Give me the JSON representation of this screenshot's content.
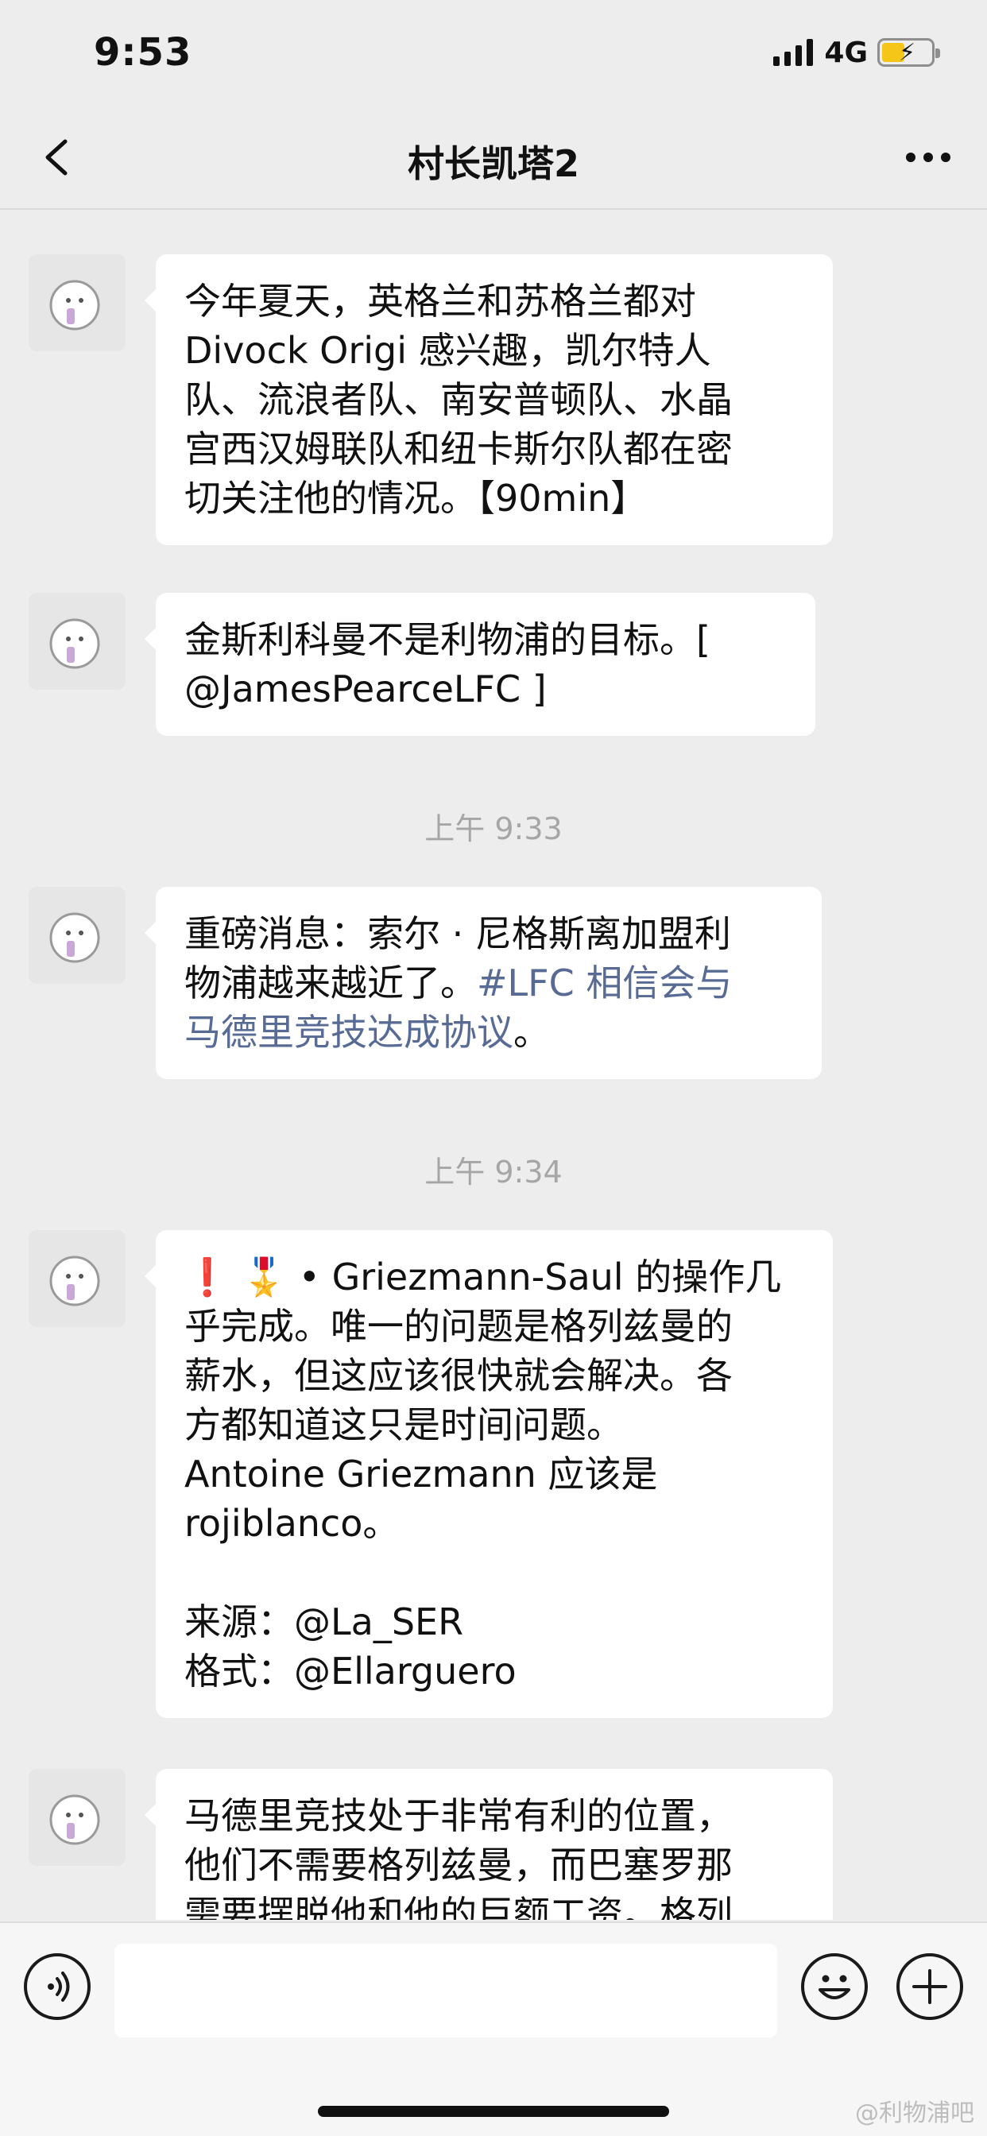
{
  "status_bar": {
    "time": "9:53",
    "network": "4G"
  },
  "nav": {
    "title": "村长凯塔2"
  },
  "messages": [
    {
      "text": "今年夏天，英格兰和苏格兰都对\nDivock Origi 感兴趣，凯尔特人\n队、流浪者队、南安普顿队、水晶\n宫西汉姆联队和纽卡斯尔队都在密\n切关注他的情况。【90min】"
    },
    {
      "text": "金斯利科曼不是利物浦的目标。[\n@JamesPearceLFC ]"
    },
    {
      "text_prefix": "重磅消息：索尔 · 尼格斯离加盟利\n物浦越来越近了。",
      "link": "#LFC 相信会与\n马德里竞技达成协议",
      "text_suffix": "。"
    },
    {
      "emoji": "❗ 🎖️",
      "text": " • Griezmann-Saul 的操作几\n乎完成。唯一的问题是格列兹曼的\n薪水，但这应该很快就会解决。各\n方都知道这只是时间问题。\nAntoine Griezmann 应该是\nrojiblanco。\n\n来源：@La_SER\n格式：@Ellarguero"
    },
    {
      "text": "马德里竞技处于非常有利的位置，\n他们不需要格列兹曼，而巴塞罗那\n需要摆脱他和他的巨额工资。格列"
    }
  ],
  "timestamps": [
    "上午 9:33",
    "上午 9:34"
  ],
  "watermark": "@利物浦吧",
  "icons": {
    "back": "chevron-left-icon",
    "more": "more-dots-icon",
    "voice": "voice-icon",
    "emoji": "emoji-icon",
    "plus": "plus-icon"
  },
  "colors": {
    "background": "#ededed",
    "bubble": "#ffffff",
    "link": "#576b95",
    "battery": "#f5c518"
  }
}
